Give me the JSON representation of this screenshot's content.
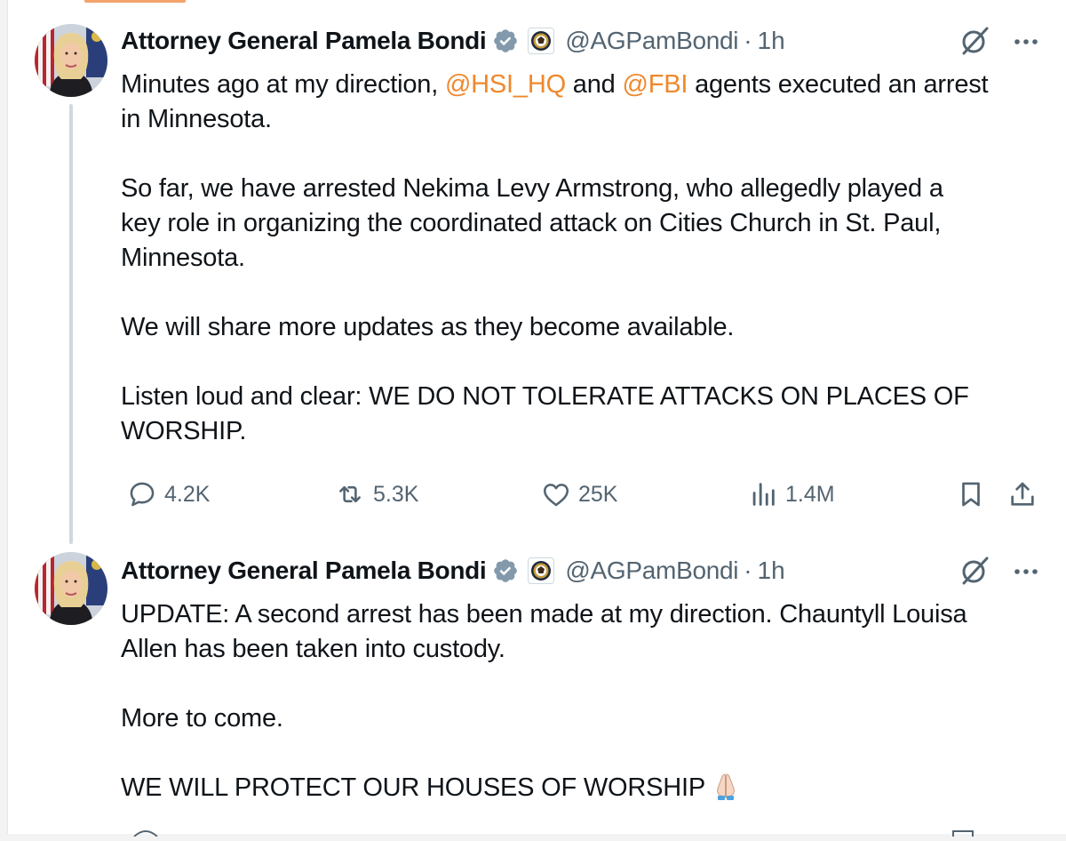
{
  "tweets": [
    {
      "author_name": "Attorney General Pamela Bondi",
      "handle": "@AGPamBondi",
      "separator": "·",
      "time": "1h",
      "body_lines": [
        {
          "parts": [
            {
              "text": "Minutes ago at my direction, "
            },
            {
              "text": "@HSI_HQ",
              "mention": true
            },
            {
              "text": " and "
            },
            {
              "text": "@FBI",
              "mention": true
            },
            {
              "text": " agents executed an arrest"
            }
          ]
        },
        {
          "parts": [
            {
              "text": "in Minnesota."
            }
          ]
        },
        {
          "gap": true
        },
        {
          "parts": [
            {
              "text": "So far, we have arrested Nekima Levy Armstrong, who allegedly played a"
            }
          ]
        },
        {
          "parts": [
            {
              "text": "key role in organizing the coordinated attack on Cities Church in St. Paul,"
            }
          ]
        },
        {
          "parts": [
            {
              "text": "Minnesota."
            }
          ]
        },
        {
          "gap": true
        },
        {
          "parts": [
            {
              "text": "We will share more updates as they become available."
            }
          ]
        },
        {
          "gap": true
        },
        {
          "parts": [
            {
              "text": "Listen loud and clear: WE DO NOT TOLERATE ATTACKS ON PLACES OF"
            }
          ]
        },
        {
          "parts": [
            {
              "text": "WORSHIP."
            }
          ]
        }
      ],
      "stats": {
        "replies": "4.2K",
        "reposts": "5.3K",
        "likes": "25K",
        "views": "1.4M"
      }
    },
    {
      "author_name": "Attorney General Pamela Bondi",
      "handle": "@AGPamBondi",
      "separator": "·",
      "time": "1h",
      "body_lines": [
        {
          "parts": [
            {
              "text": "UPDATE: A second arrest has been made at my direction. Chauntyll Louisa"
            }
          ]
        },
        {
          "parts": [
            {
              "text": "Allen has been taken into custody."
            }
          ]
        },
        {
          "gap": true
        },
        {
          "parts": [
            {
              "text": "More to come."
            }
          ]
        },
        {
          "gap": true
        },
        {
          "parts": [
            {
              "text": "WE WILL PROTECT OUR HOUSES OF WORSHIP"
            }
          ],
          "emoji": "folded-hands-emoji"
        }
      ]
    }
  ],
  "colors": {
    "mention": "#f0882b",
    "verified_badge": "#829aab",
    "secondary_text": "#536471",
    "thread_line": "#cfd9de"
  },
  "icons": {
    "verified": "verified-badge-icon",
    "affiliation": "doj-seal-icon",
    "grok": "grok-icon",
    "more": "more-dots-icon",
    "reply": "reply-icon",
    "repost": "repost-icon",
    "like": "like-icon",
    "views": "views-icon",
    "bookmark": "bookmark-icon",
    "share": "share-icon"
  }
}
